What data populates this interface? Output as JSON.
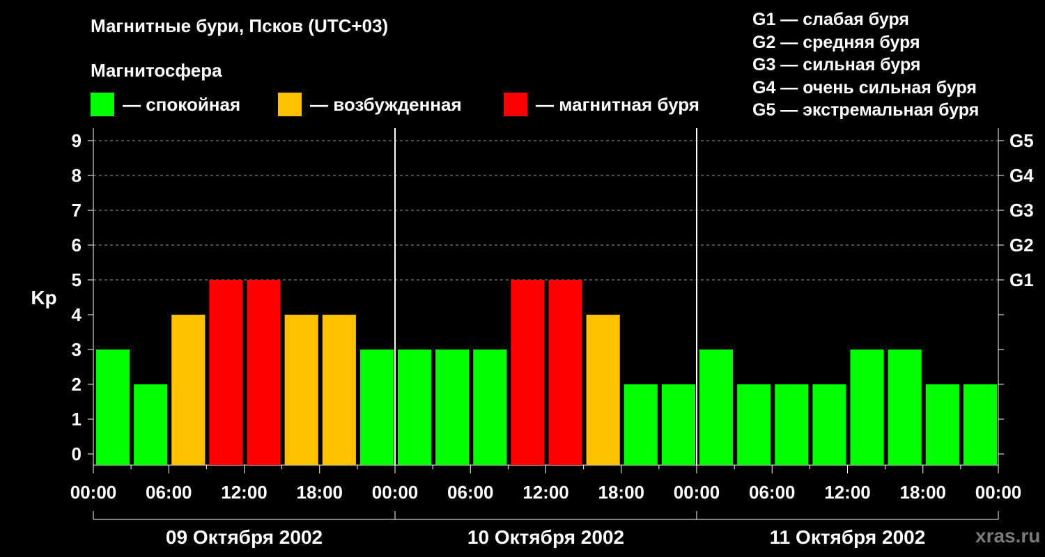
{
  "title": "Магнитные бури, Псков (UTC+03)",
  "subtitle": "Магнитосфера",
  "colors": {
    "quiet": "#00ff00",
    "active": "#ffc000",
    "storm": "#ff0000",
    "background": "#000000"
  },
  "legend": [
    {
      "key": "quiet",
      "label": "— спокойная"
    },
    {
      "key": "active",
      "label": "— возбужденная"
    },
    {
      "key": "storm",
      "label": "— магнитная буря"
    }
  ],
  "g_scale": [
    "G1 — слабая буря",
    "G2 — средняя буря",
    "G3 — сильная буря",
    "G4 — очень сильная буря",
    "G5 — экстремальная буря"
  ],
  "watermark": "xras.ru",
  "chart_data": {
    "type": "bar",
    "ylabel": "Kp",
    "ylim": [
      0,
      9
    ],
    "y_ticks": [
      "0",
      "1",
      "2",
      "3",
      "4",
      "5",
      "6",
      "7",
      "8",
      "9"
    ],
    "right_ticks": [
      {
        "value": 5,
        "label": "G1"
      },
      {
        "value": 6,
        "label": "G2"
      },
      {
        "value": 7,
        "label": "G3"
      },
      {
        "value": 8,
        "label": "G4"
      },
      {
        "value": 9,
        "label": "G5"
      }
    ],
    "grid": "dashed horizontal at 5–9",
    "x_tick_labels": [
      "00:00",
      "06:00",
      "12:00",
      "18:00",
      "00:00",
      "06:00",
      "12:00",
      "18:00",
      "00:00",
      "06:00",
      "12:00",
      "18:00",
      "00:00"
    ],
    "days": [
      "09 Октября 2002",
      "10 Октября 2002",
      "11 Октября 2002"
    ],
    "interval_hours": 3,
    "values": [
      3,
      2,
      4,
      5,
      5,
      4,
      4,
      3,
      3,
      3,
      3,
      5,
      5,
      4,
      2,
      2,
      3,
      2,
      2,
      2,
      3,
      3,
      2,
      2
    ],
    "thresholds": {
      "active_at": 4,
      "storm_at": 5
    }
  }
}
